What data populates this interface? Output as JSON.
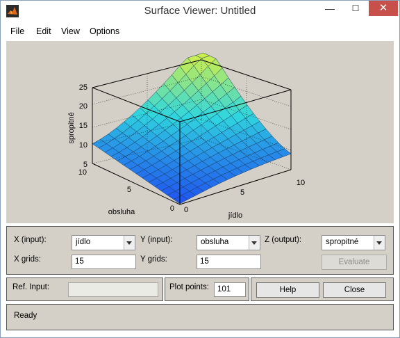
{
  "window": {
    "title": "Surface Viewer: Untitled",
    "minimize": "—",
    "maximize": "☐",
    "close": "✕"
  },
  "menu": {
    "items": [
      "File",
      "Edit",
      "View",
      "Options"
    ]
  },
  "plot": {
    "z_label": "spropitné",
    "x_label": "jídlo",
    "y_label": "obsluha",
    "z_ticks": [
      "5",
      "10",
      "15",
      "20",
      "25"
    ],
    "x_ticks": [
      "0",
      "5",
      "10"
    ],
    "y_ticks": [
      "0",
      "5",
      "10"
    ],
    "colors": {
      "low": "#1f4ff0",
      "mid": "#2fd7df",
      "high": "#cbee4e",
      "bg": "#d4d0c8"
    }
  },
  "controls": {
    "x_input_label": "X (input):",
    "x_input_value": "jídlo",
    "y_input_label": "Y (input):",
    "y_input_value": "obsluha",
    "z_output_label": "Z (output):",
    "z_output_value": "spropitné",
    "x_grids_label": "X grids:",
    "x_grids_value": "15",
    "y_grids_label": "Y grids:",
    "y_grids_value": "15",
    "evaluate_label": "Evaluate",
    "ref_input_label": "Ref. Input:",
    "ref_input_value": "",
    "plot_points_label": "Plot points:",
    "plot_points_value": "101",
    "help_label": "Help",
    "close_label": "Close"
  },
  "status": {
    "text": "Ready"
  }
}
